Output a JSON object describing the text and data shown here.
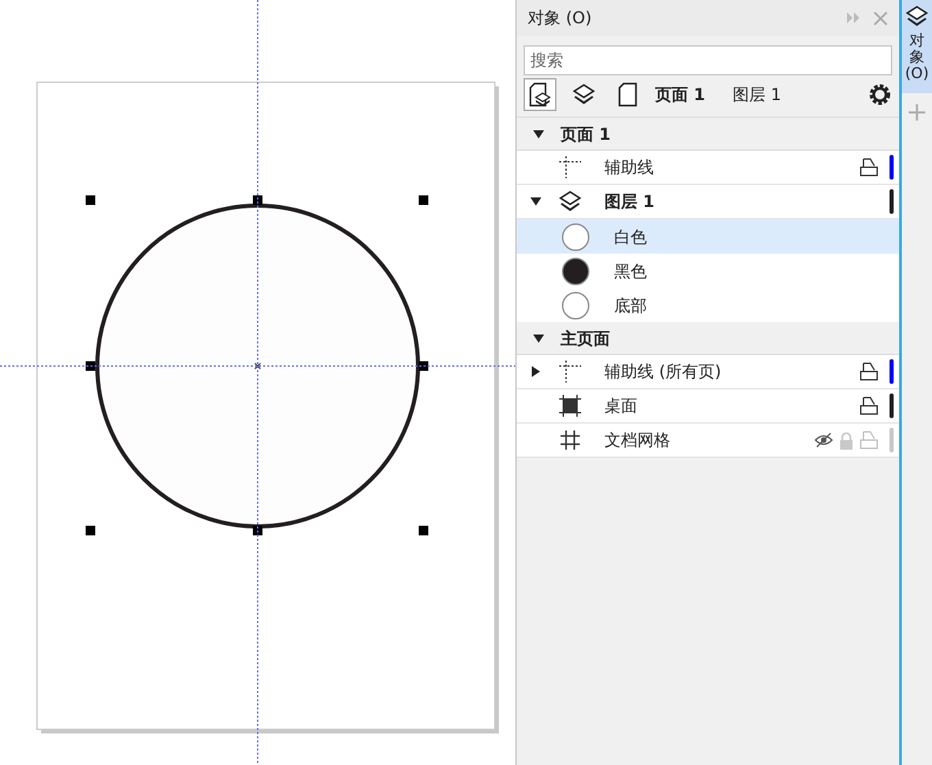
{
  "panel": {
    "title": "对象 (O)",
    "search": {
      "placeholder": "搜索"
    },
    "toolbar": {
      "views": [
        {
          "kind": "page-layer",
          "selected": true
        },
        {
          "kind": "layers",
          "selected": false
        },
        {
          "kind": "page",
          "selected": false
        }
      ],
      "page_label": "页面 1",
      "layer_label": "图层 1"
    },
    "pages": [
      {
        "name": "页面 1",
        "expanded": true,
        "items": [
          {
            "kind": "guides",
            "name": "辅助线",
            "visible": true,
            "color": "#0000ff"
          },
          {
            "kind": "layer",
            "name": "图层 1",
            "expanded": true,
            "color": "#231f20",
            "children": [
              {
                "kind": "object",
                "name": "白色",
                "color": "#ffffff",
                "selected": true
              },
              {
                "kind": "object",
                "name": "黑色",
                "color": "#231f20",
                "selected": false
              },
              {
                "kind": "object",
                "name": "底部",
                "color": "#ffffff",
                "selected": false
              }
            ]
          }
        ]
      },
      {
        "name": "主页面",
        "expanded": true,
        "items": [
          {
            "kind": "guides",
            "name": "辅助线 (所有页)",
            "expanded": false,
            "visible": true,
            "color": "#0000ff"
          },
          {
            "kind": "desktop",
            "name": "桌面",
            "visible": true,
            "color": "#231f20"
          },
          {
            "kind": "grid",
            "name": "文档网格",
            "visible": false,
            "color": "#c8c8c8"
          }
        ]
      }
    ]
  },
  "side_tab": {
    "label": "对象 (O)"
  }
}
